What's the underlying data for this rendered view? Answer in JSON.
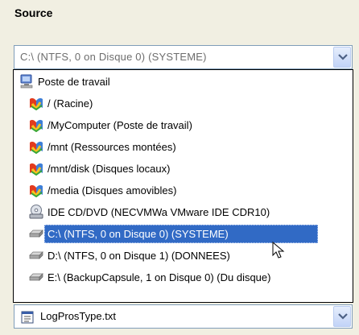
{
  "source": {
    "title": "Source",
    "combo_value": "C:\\  (NTFS, 0 on Disque 0) (SYSTEME)"
  },
  "dropdown": {
    "items": [
      {
        "label": "Poste de travail",
        "icon": "computer-icon"
      },
      {
        "label": "/ (Racine)",
        "icon": "linux-folder-icon"
      },
      {
        "label": "/MyComputer (Poste de travail)",
        "icon": "linux-folder-icon"
      },
      {
        "label": "/mnt (Ressources montées)",
        "icon": "linux-folder-icon"
      },
      {
        "label": "/mnt/disk (Disques locaux)",
        "icon": "linux-folder-icon"
      },
      {
        "label": "/media (Disques amovibles)",
        "icon": "linux-folder-icon"
      },
      {
        "label": "IDE CD/DVD (NECVMWa VMware IDE CDR10)",
        "icon": "cd-drive-icon"
      },
      {
        "label": "C:\\  (NTFS, 0 on Disque 0) (SYSTEME)",
        "icon": "hard-drive-icon",
        "selected": true
      },
      {
        "label": "D:\\  (NTFS, 0 on Disque 1) (DONNEES)",
        "icon": "hard-drive-icon"
      },
      {
        "label": "E:\\  (BackupCapsule, 1 on Disque 0) (Du disque)",
        "icon": "hard-drive-icon"
      }
    ]
  },
  "file": {
    "value": "LogProsType.txt"
  },
  "colors": {
    "selection": "#316ac5",
    "window_bg": "#f1efe2",
    "combo_border": "#7f9db9"
  }
}
